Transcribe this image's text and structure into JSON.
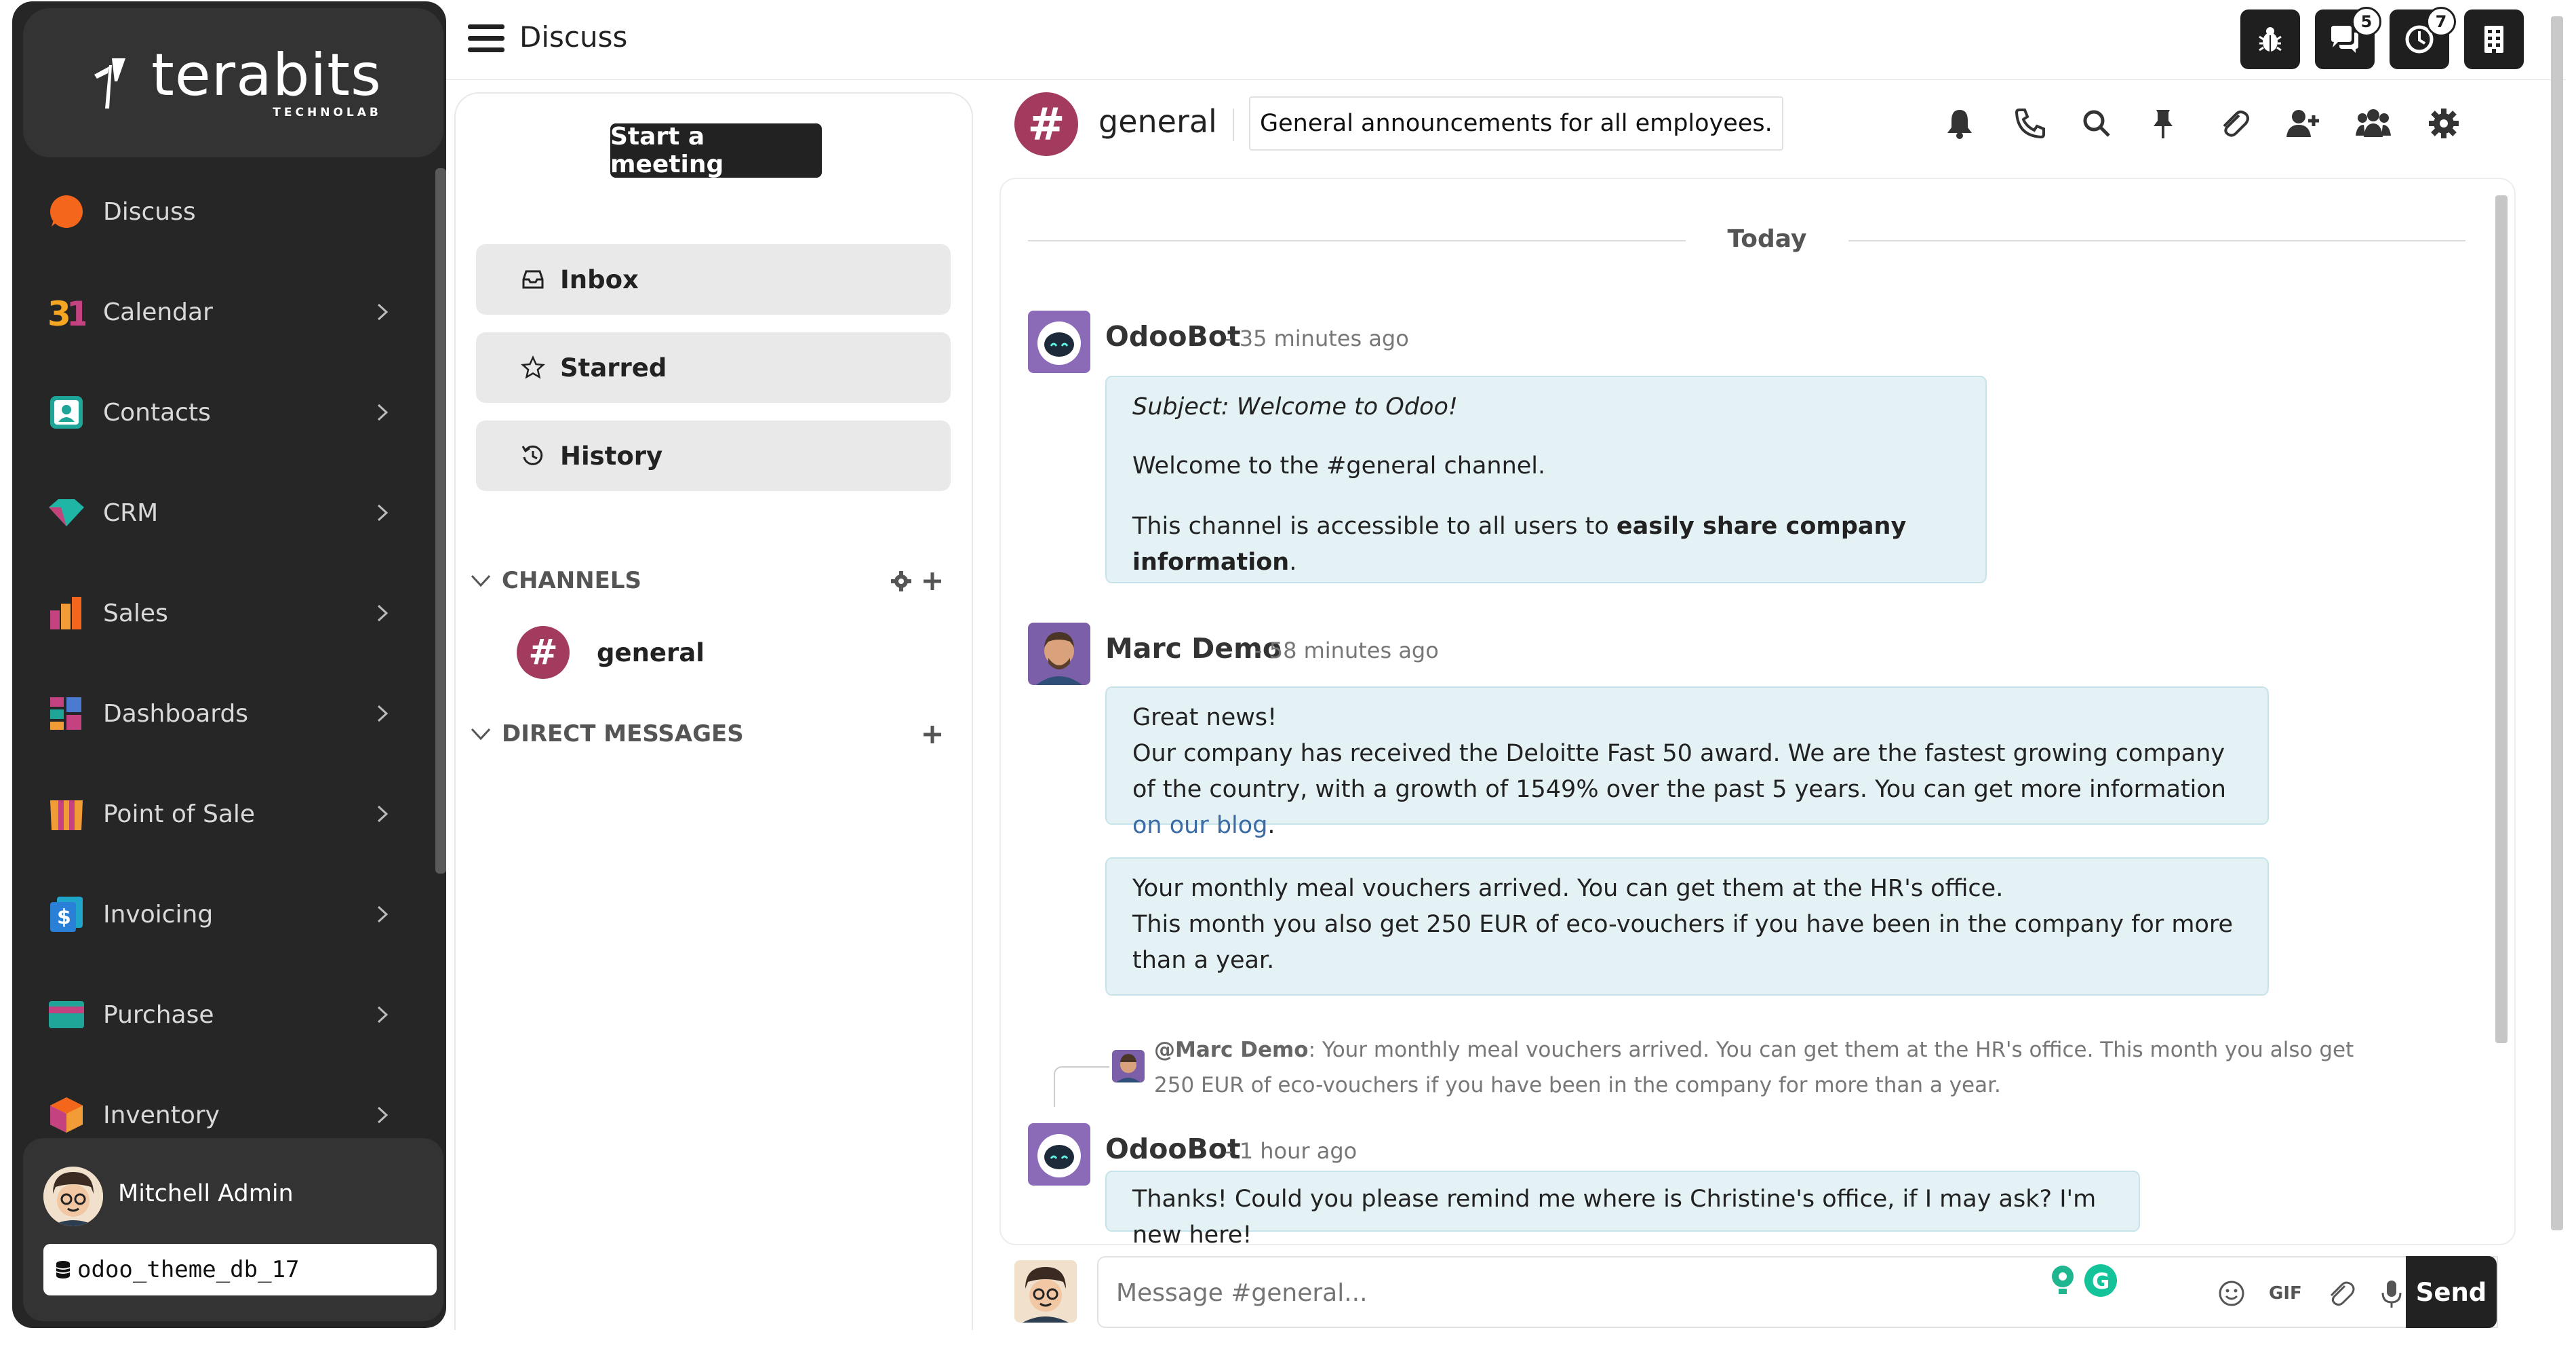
{
  "brand": {
    "name": "terabits",
    "sub": "TECHNOLAB"
  },
  "topbar": {
    "title": "Discuss",
    "messages_badge": "5",
    "activity_badge": "7"
  },
  "sidebar": {
    "items": [
      {
        "label": "Discuss",
        "icon": "discuss-icon"
      },
      {
        "label": "Calendar",
        "icon": "calendar-icon"
      },
      {
        "label": "Contacts",
        "icon": "contacts-icon"
      },
      {
        "label": "CRM",
        "icon": "crm-icon"
      },
      {
        "label": "Sales",
        "icon": "sales-icon"
      },
      {
        "label": "Dashboards",
        "icon": "dashboards-icon"
      },
      {
        "label": "Point of Sale",
        "icon": "point-of-sale-icon"
      },
      {
        "label": "Invoicing",
        "icon": "invoicing-icon"
      },
      {
        "label": "Purchase",
        "icon": "purchase-icon"
      },
      {
        "label": "Inventory",
        "icon": "inventory-icon"
      }
    ],
    "user": {
      "name": "Mitchell Admin",
      "database": "odoo_theme_db_17"
    }
  },
  "discuss_panel": {
    "start_meeting": "Start a meeting",
    "nav": {
      "inbox": "Inbox",
      "starred": "Starred",
      "history": "History"
    },
    "channels_header": "CHANNELS",
    "direct_messages_header": "DIRECT MESSAGES",
    "channels": [
      {
        "name": "general"
      }
    ]
  },
  "thread": {
    "name": "general",
    "description": "General announcements for all employees.",
    "date_separator": "Today",
    "messages": [
      {
        "author": "OdooBot",
        "time": "- 35 minutes ago",
        "subject": "Subject: Welcome to Odoo!",
        "line1": "Welcome to the #general channel.",
        "line2_pre": "This channel is accessible to all users to ",
        "line2_bold": "easily share company information",
        "line2_post": "."
      },
      {
        "author": "Marc Demo",
        "time": "- 58 minutes ago",
        "line1": "Great news!",
        "line2": "Our company has received the Deloitte Fast 50 award. We are the fastest growing company of the country, with a growth of 1549% over the past 5 years. You can get more information ",
        "link": "on our blog",
        "line2_post": "."
      },
      {
        "line1": "Your monthly meal vouchers arrived. You can get them at the HR's office.",
        "line2": "This month you also get 250 EUR of eco-vouchers if you have been in the company for more than a year."
      },
      {
        "author": "OdooBot",
        "time": "- 1 hour ago",
        "reply_to": "@Marc Demo",
        "reply_text": ":  Your monthly meal vouchers arrived. You can get them at the HR's office. This month you also get 250 EUR of eco-vouchers if you have been in the company for more than a year.",
        "text": "Thanks! Could you please remind me where is Christine's office, if I may ask? I'm new here!"
      }
    ]
  },
  "composer": {
    "placeholder": "Message #general...",
    "send_label": "Send",
    "gif_label": "GIF"
  },
  "colors": {
    "sidebar_bg": "#262626",
    "channel_avatar": "#a33b5f",
    "bubble_bg": "#e4f2f5",
    "link": "#3b6ba5"
  }
}
